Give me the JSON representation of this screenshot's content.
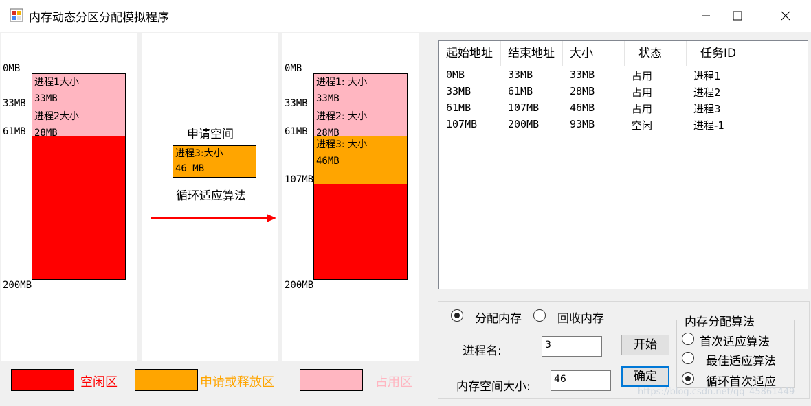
{
  "window": {
    "title": "内存动态分区分配模拟程序"
  },
  "left_panel": {
    "labels": {
      "top": "0MB",
      "p33": "33MB",
      "p61": "61MB",
      "bottom": "200MB"
    },
    "blocks": [
      {
        "line1": "进程1大小",
        "line2": "33MB"
      },
      {
        "line1": "进程2大小",
        "line2": "28MB"
      }
    ]
  },
  "middle_panel": {
    "request_title": "申请空间",
    "request_block": {
      "line1": "进程3:大小",
      "line2": "46 MB"
    },
    "algorithm": "循环适应算法"
  },
  "right_panel": {
    "labels": {
      "top": "0MB",
      "p33": "33MB",
      "p61": "61MB",
      "p107": "107MB",
      "bottom": "200MB"
    },
    "blocks": [
      {
        "line1": "进程1: 大小",
        "line2": "33MB"
      },
      {
        "line1": "进程2: 大小",
        "line2": "28MB"
      },
      {
        "line1": "进程3: 大小",
        "line2": "46MB"
      }
    ]
  },
  "legend": {
    "free": "空闲区",
    "request": "申请或释放区",
    "used": "占用区"
  },
  "colors": {
    "free": "#ff0000",
    "request": "#ffa500",
    "used": "#ffb6c1",
    "arrow": "#ff0000",
    "focus": "#0078d7"
  },
  "table": {
    "columns": [
      "起始地址",
      "结束地址",
      "大小",
      "状态",
      "任务ID"
    ],
    "rows": [
      [
        "0MB",
        "33MB",
        "33MB",
        "占用",
        "进程1"
      ],
      [
        "33MB",
        "61MB",
        "28MB",
        "占用",
        "进程2"
      ],
      [
        "61MB",
        "107MB",
        "46MB",
        "占用",
        "进程3"
      ],
      [
        "107MB",
        "200MB",
        "93MB",
        "空闲",
        "进程-1"
      ]
    ]
  },
  "controls": {
    "mode_allocate": "分配内存",
    "mode_recycle": "回收内存",
    "process_name_label": "进程名:",
    "process_name_value": "3",
    "size_label": "内存空间大小:",
    "size_value": "46",
    "start_button": "开始",
    "ok_button": "确定",
    "algo_group_title": "内存分配算法",
    "algo_first": "首次适应算法",
    "algo_best": "最佳适应算法",
    "algo_next": "循环首次适应",
    "selected_mode": "allocate",
    "selected_algo": "next"
  },
  "watermark": "https://blog.csdn.net/qq_45861449"
}
